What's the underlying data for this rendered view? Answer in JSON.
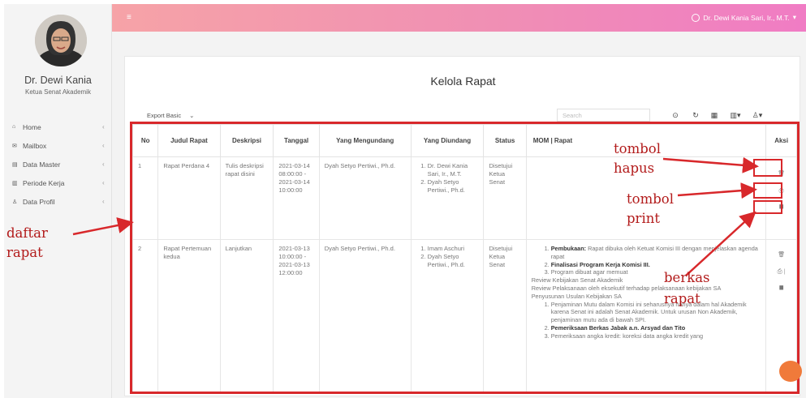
{
  "sidebar": {
    "profile_name": "Dr. Dewi Kania",
    "profile_role": "Ketua Senat Akademik",
    "items": [
      {
        "icon": "home-icon",
        "glyph": "⌂",
        "label": "Home"
      },
      {
        "icon": "mail-icon",
        "glyph": "✉",
        "label": "Mailbox"
      },
      {
        "icon": "database-icon",
        "glyph": "▤",
        "label": "Data Master"
      },
      {
        "icon": "chart-icon",
        "glyph": "▥",
        "label": "Periode Kerja"
      },
      {
        "icon": "user-icon",
        "glyph": "♙",
        "label": "Data Profil"
      }
    ],
    "chevron": "‹"
  },
  "topbar": {
    "hamburger": "≡",
    "user_label": "Dr. Dewi Kania Sari, Ir., M.T.",
    "dropdown": "▾"
  },
  "page": {
    "title": "Kelola Rapat"
  },
  "toolbar": {
    "export_label": "Export Basic",
    "export_chevron": "⌄",
    "search_placeholder": "Search",
    "buttons": [
      "⊙",
      "↻",
      "▦",
      "▥▾",
      "♙▾"
    ]
  },
  "table": {
    "headers": [
      "No",
      "Judul Rapat",
      "Deskripsi",
      "Tanggal",
      "Yang Mengundang",
      "Yang Diundang",
      "Status",
      "MOM | Rapat",
      "Aksi"
    ],
    "rows": [
      {
        "no": "1",
        "judul": "Rapat Perdana 4",
        "deskripsi": "Tulis deskripsi rapat disini",
        "tanggal": "2021-03-14 08:00:00 - 2021-03-14 10:00:00",
        "mengundang": "Dyah Setyo Pertiwi., Ph.d.",
        "diundang": [
          "Dr. Dewi Kania Sari, Ir., M.T.",
          "Dyah Setyo Pertiwi., Ph.d."
        ],
        "status": "Disetujui Ketua Senat"
      },
      {
        "no": "2",
        "judul": "Rapat Pertemuan kedua",
        "deskripsi": "Lanjutkan",
        "tanggal": "2021-03-13 10:00:00 - 2021-03-13 12:00:00",
        "mengundang": "Dyah Setyo Pertiwi., Ph.d.",
        "diundang": [
          "Imam Aschuri",
          "Dyah Setyo Pertiwi., Ph.d."
        ],
        "status": "Disetujui Ketua Senat",
        "mom": {
          "list1": [
            {
              "bold": "Pembukaan:",
              "text": " Rapat dibuka oleh Ketuat Komisi III dengan menjelaskan agenda rapat"
            },
            {
              "bold": "Finalisasi Program Kerja Komisi III.",
              "text": ""
            },
            {
              "bold": "",
              "text": "Program dibuat agar memuat"
            }
          ],
          "paras": [
            "Review Kebijakan Senat Akademik",
            "Review Pelaksanaan oleh eksekutif terhadap pelaksanaan kebijakan SA",
            "Penyusunan Usulan Kebijakan SA"
          ],
          "list2": [
            {
              "bold": "",
              "text": "Penjaminan Mutu dalam Komisi ini seharusnya hanya dalam hal Akademik karena Senat ini adalah Senat Akademik. Untuk urusan Non Akademik, penjaminan mutu ada di bawah SPI."
            },
            {
              "bold": "Pemeriksaan Berkas Jabak a.n. Arsyad dan Tito",
              "text": ""
            },
            {
              "bold": "",
              "text": "Pemeriksaan angka kredit: koreksi data angka kredit yang"
            }
          ]
        }
      }
    ],
    "aksi_icons": {
      "delete": "🗑",
      "print": "⎙",
      "file": "▆",
      "sep": "|"
    }
  },
  "annotations": {
    "tombol_hapus": [
      "tombol",
      "hapus"
    ],
    "tombol_print": [
      "tombol",
      "print"
    ],
    "berkas_rapat": [
      "berkas",
      "rapat"
    ],
    "daftar_rapat": [
      "daftar",
      "rapat"
    ]
  },
  "colors": {
    "annotation_red": "#d8282b",
    "topbar_start": "#f6a3a7",
    "topbar_end": "#f07cc4",
    "chat_orange": "#f07a3a"
  }
}
